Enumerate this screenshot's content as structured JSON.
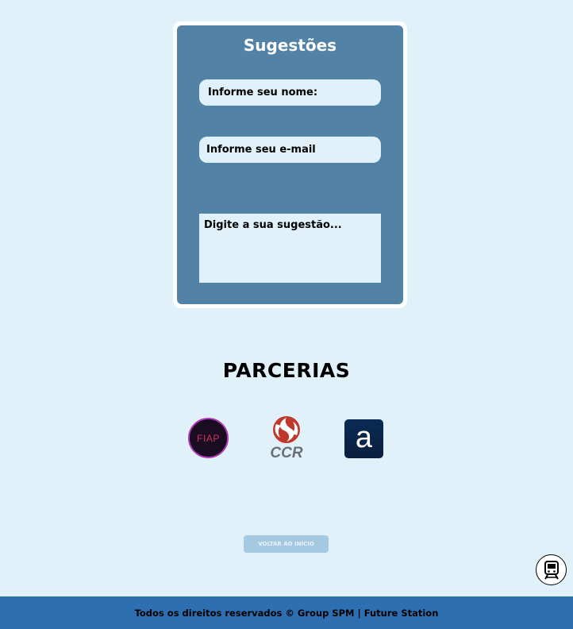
{
  "suggestion_form": {
    "title": "Sugestões",
    "name_placeholder": "Informe seu nome:",
    "email_placeholder": "Informe seu e-mail",
    "suggestion_placeholder": "Digite a sua sugestão..."
  },
  "partners": {
    "title": "PARCERIAS",
    "logos": [
      {
        "name": "fiap-logo",
        "text": "FIAP",
        "colors": {
          "bg": "#1a0d22",
          "text": "#d2325a",
          "ring": "#b03ab8"
        }
      },
      {
        "name": "ccr-logo",
        "text": "CCR",
        "colors": {
          "mark": "#c0382b",
          "text": "#6b6f73"
        }
      },
      {
        "name": "a-logo",
        "text": "a",
        "colors": {
          "bg": "#0a2a55",
          "text": "#ffffff"
        }
      }
    ]
  },
  "back_button": {
    "label": "VOLTAR AO INÍCIO"
  },
  "floating_button": {
    "icon": "train-icon"
  },
  "footer": {
    "text": "Todos os direitos reservados © Group SPM | Future Station"
  },
  "colors": {
    "page_bg": "#e1f1fa",
    "card_bg": "#5282a5",
    "footer_bg": "#2e6fb2",
    "button_bg": "#a6c9e2"
  }
}
